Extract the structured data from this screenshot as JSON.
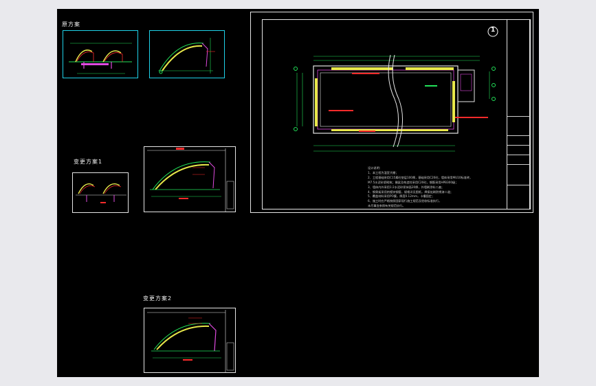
{
  "sheet": {
    "background": "#000000",
    "line_colors": {
      "frame_cyan": "#1fd3ea",
      "frame_white": "#e6e6e6",
      "dimension_green": "#22e35a",
      "annotation_red": "#ff2b2b",
      "wall_magenta": "#e04be0",
      "fill_yellow": "#e8e84a"
    }
  },
  "labels": {
    "original_scheme": "原方案",
    "change_scheme_1": "变更方案1",
    "change_scheme_2": "变更方案2"
  },
  "main_plan": {
    "north_symbol": "1",
    "notes": [
      "设计说明：",
      "1、本工程为温室大棚；",
      "2、工程基础采用C15素砼垫层100厚，基础采用C20砼，墙体采用MU10标准砖，",
      "M7.5水泥砂浆砌筑；圈梁及构造柱采用C20砼，钢筋采用HPB300级；",
      "3、墙体内外采用1:2水泥砂浆抹面20厚，外墙刷涂料二遍；",
      "4、钢骨架采用热镀锌钢管，规格详见图纸，焊接处刷防锈漆二道；",
      "5、覆盖材料采用PO膜，厚度0.12mm，卡槽固定；",
      "6、施工时应严格按照国家现行施工规范及验收标准执行，",
      "未尽事宜参照有关规范执行。"
    ]
  }
}
